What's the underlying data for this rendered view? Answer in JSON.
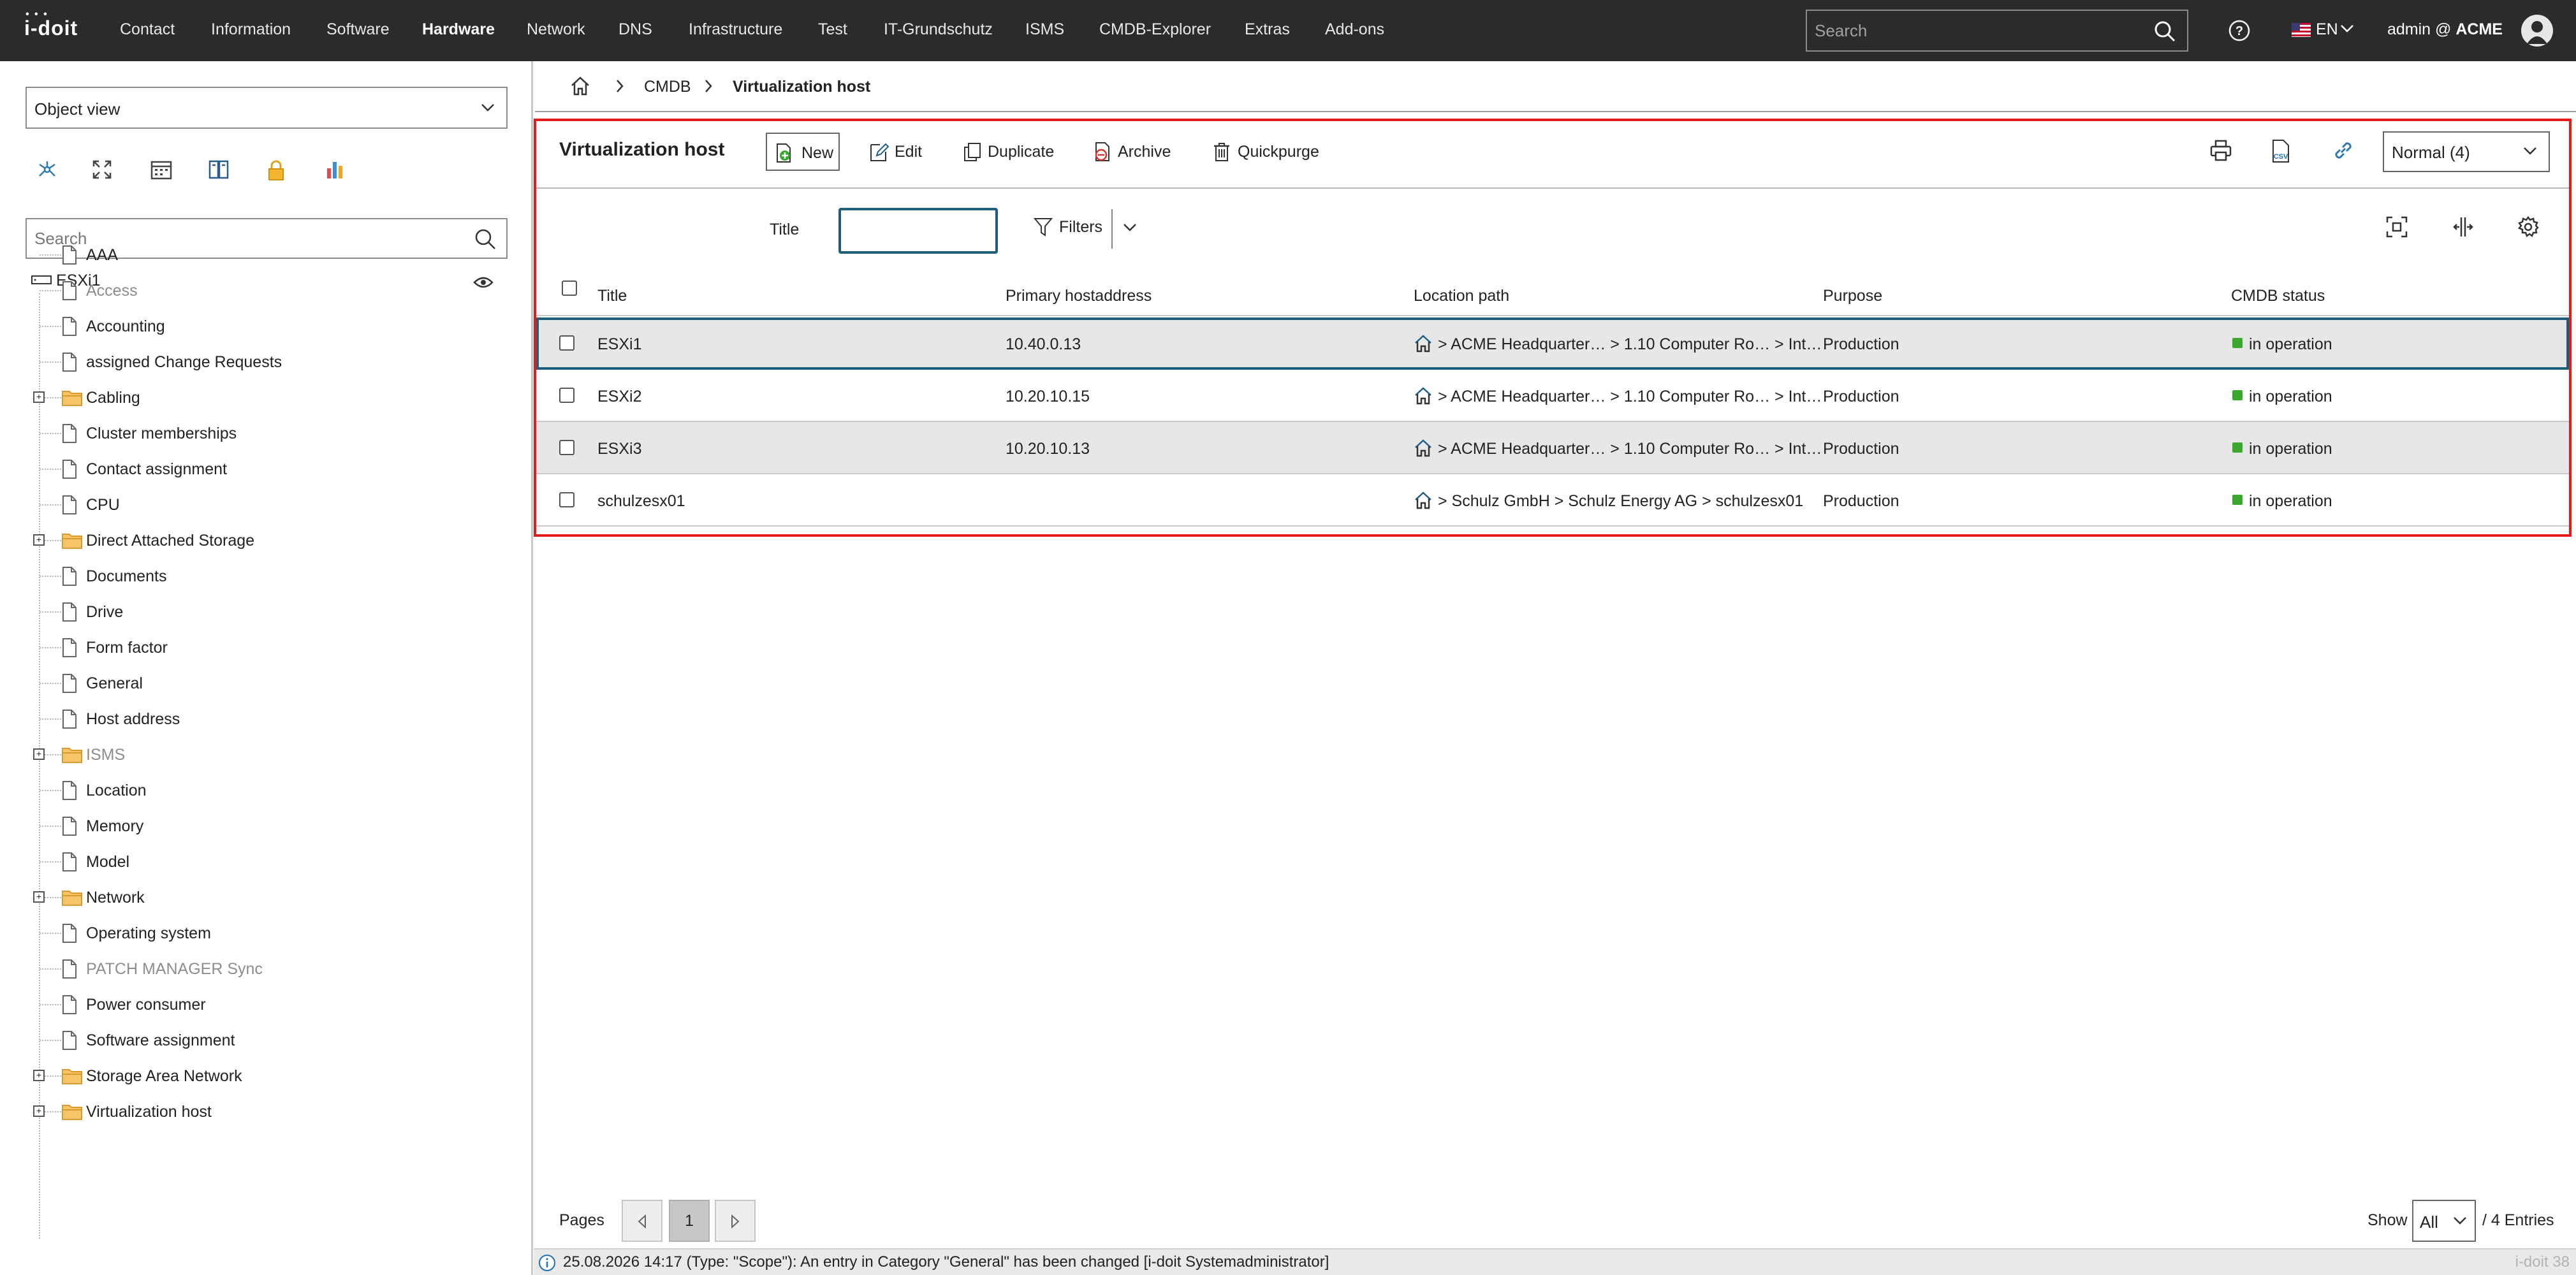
{
  "app": {
    "logo_text": "i-doit",
    "nav": [
      "Contact",
      "Information",
      "Software",
      "Hardware",
      "Network",
      "DNS",
      "Infrastructure",
      "Test",
      "IT-Grundschutz",
      "ISMS",
      "CMDB-Explorer",
      "Extras",
      "Add-ons"
    ],
    "nav_active": "Hardware",
    "search_placeholder": "Search",
    "language": "EN",
    "user_prefix": "admin @",
    "tenant": "ACME"
  },
  "left": {
    "view_select": "Object view",
    "tools": [
      "relations-icon",
      "expand-icon",
      "calendar-icon",
      "book-icon",
      "lock-icon",
      "report-chart-icon"
    ],
    "search_placeholder": "Search",
    "root_label": "ESXi1",
    "tree": [
      {
        "label": "AAA",
        "folder": false,
        "muted": false
      },
      {
        "label": "Access",
        "folder": false,
        "muted": true
      },
      {
        "label": "Accounting",
        "folder": false,
        "muted": false
      },
      {
        "label": "assigned Change Requests",
        "folder": false,
        "muted": false
      },
      {
        "label": "Cabling",
        "folder": true,
        "muted": false
      },
      {
        "label": "Cluster memberships",
        "folder": false,
        "muted": false
      },
      {
        "label": "Contact assignment",
        "folder": false,
        "muted": false
      },
      {
        "label": "CPU",
        "folder": false,
        "muted": false
      },
      {
        "label": "Direct Attached Storage",
        "folder": true,
        "muted": false
      },
      {
        "label": "Documents",
        "folder": false,
        "muted": false
      },
      {
        "label": "Drive",
        "folder": false,
        "muted": false
      },
      {
        "label": "Form factor",
        "folder": false,
        "muted": false
      },
      {
        "label": "General",
        "folder": false,
        "muted": false
      },
      {
        "label": "Host address",
        "folder": false,
        "muted": false
      },
      {
        "label": "ISMS",
        "folder": true,
        "muted": true
      },
      {
        "label": "Location",
        "folder": false,
        "muted": false
      },
      {
        "label": "Memory",
        "folder": false,
        "muted": false
      },
      {
        "label": "Model",
        "folder": false,
        "muted": false
      },
      {
        "label": "Network",
        "folder": true,
        "muted": false
      },
      {
        "label": "Operating system",
        "folder": false,
        "muted": false
      },
      {
        "label": "PATCH MANAGER Sync",
        "folder": false,
        "muted": true
      },
      {
        "label": "Power consumer",
        "folder": false,
        "muted": false
      },
      {
        "label": "Software assignment",
        "folder": false,
        "muted": false
      },
      {
        "label": "Storage Area Network",
        "folder": true,
        "muted": false
      },
      {
        "label": "Virtualization host",
        "folder": true,
        "muted": false
      }
    ]
  },
  "breadcrumb": {
    "cmdb": "CMDB",
    "current": "Virtualization host"
  },
  "toolbar": {
    "title": "Virtualization host",
    "new": "New",
    "edit": "Edit",
    "duplicate": "Duplicate",
    "archive": "Archive",
    "quickpurge": "Quickpurge",
    "view_mode": "Normal (4)"
  },
  "filter": {
    "label": "Title",
    "value": "",
    "filters_label": "Filters"
  },
  "table": {
    "columns": [
      "Title",
      "Primary hostaddress",
      "Location path",
      "Purpose",
      "CMDB status"
    ],
    "rows": [
      {
        "title": "ESXi1",
        "host": "10.40.0.13",
        "location": "> ACME Headquarter… > 1.10 Computer Ro… > Int…",
        "purpose": "Production",
        "status": "in operation",
        "state": "selected"
      },
      {
        "title": "ESXi2",
        "host": "10.20.10.15",
        "location": "> ACME Headquarter… > 1.10 Computer Ro… > Int…",
        "purpose": "Production",
        "status": "in operation",
        "state": "plain"
      },
      {
        "title": "ESXi3",
        "host": "10.20.10.13",
        "location": "> ACME Headquarter… > 1.10 Computer Ro… > Int…",
        "purpose": "Production",
        "status": "in operation",
        "state": "shaded"
      },
      {
        "title": "schulzesx01",
        "host": "",
        "location": "> Schulz GmbH > Schulz Energy AG > schulzesx01",
        "purpose": "Production",
        "status": "in operation",
        "state": "plain"
      }
    ],
    "status_color": "#3aa82e"
  },
  "pager": {
    "pages_label": "Pages",
    "current_page": "1",
    "show_label": "Show",
    "show_value": "All",
    "entries": "/ 4 Entries"
  },
  "status": {
    "message": "25.08.2026 14:17 (Type: \"Scope\"): An entry in Category \"General\" has been changed [i-doit Systemadministrator]",
    "version": "i-doit 38"
  }
}
